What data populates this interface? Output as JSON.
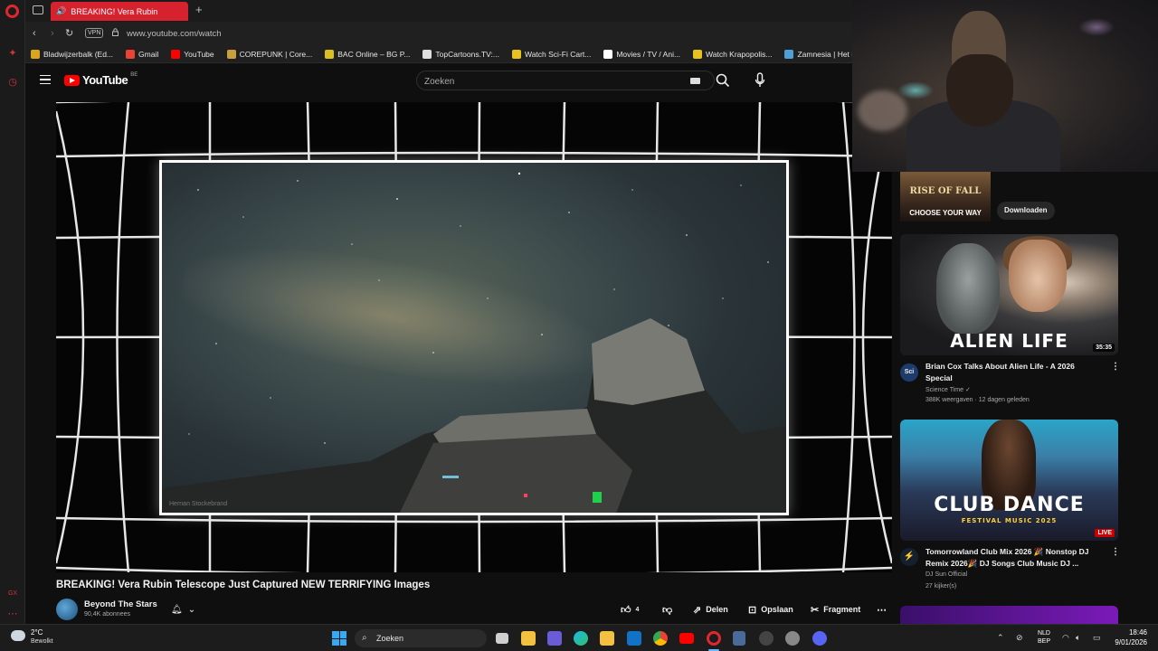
{
  "browser": {
    "tab_title": "BREAKING! Vera Rubin",
    "url": "www.youtube.com/watch",
    "vpn_label": "VPN",
    "new_tab_symbol": "+",
    "bookmarks": [
      {
        "label": "Bladwijzerbalk (Ed...",
        "icon": "folder-icon",
        "color": "#d9a520"
      },
      {
        "label": "Gmail",
        "icon": "gmail-icon",
        "color": "#ea4335"
      },
      {
        "label": "YouTube",
        "icon": "youtube-icon",
        "color": "#ff0000"
      },
      {
        "label": "COREPUNK | Core...",
        "icon": "corepunk-icon",
        "color": "#c8a040"
      },
      {
        "label": "BAC Online – BG P...",
        "icon": "bac-icon",
        "color": "#d9c020"
      },
      {
        "label": "TopCartoons.TV:...",
        "icon": "topcartoons-icon",
        "color": "#e0e0e0"
      },
      {
        "label": "Watch Sci-Fi Cart...",
        "icon": "scifi-icon",
        "color": "#e8c020"
      },
      {
        "label": "Movies / TV / Ani...",
        "icon": "play-icon",
        "color": "#ffffff"
      },
      {
        "label": "Watch Krapopolis...",
        "icon": "krapopolis-icon",
        "color": "#e8c020"
      },
      {
        "label": "Zamnesia | Het Be",
        "icon": "zamnesia-icon",
        "color": "#4fa0d8"
      }
    ]
  },
  "youtube": {
    "logo_text": "YouTube",
    "country_code": "BE",
    "search_placeholder": "Zoeken"
  },
  "video": {
    "title": "BREAKING! Vera Rubin Telescope Just Captured NEW TERRIFYING Images",
    "watermark": "Hernan Stockebrand",
    "channel_name": "Beyond The Stars",
    "subscribers": "90,4K abonnees",
    "like_count": "4",
    "actions": {
      "share": "Delen",
      "save": "Opslaan",
      "clip": "Fragment"
    }
  },
  "sidebar": {
    "ad": {
      "line1": "RISE OF FALL",
      "line2": "CHOOSE YOUR WAY",
      "download_label": "Downloaden"
    },
    "recommendations": [
      {
        "thumb_text": "ALIEN LIFE",
        "duration": "35:35",
        "title": "Brian Cox Talks About Alien Life - A 2026 Special",
        "channel": "Science Time",
        "meta": "388K weergaven · 12 dagen geleden",
        "avatar_text": "Sci"
      },
      {
        "thumb_text": "CLUB DANCE",
        "thumb_sub": "FESTIVAL MUSIC 2025",
        "badge": "LIVE",
        "title": "Tomorrowland Club Mix 2026 🎉 Nonstop DJ Remix 2026🎉 DJ Songs Club Music DJ ...",
        "channel": "DJ Sun Official",
        "meta": "27 kijker(s)"
      }
    ]
  },
  "taskbar": {
    "weather_temp": "2°C",
    "weather_desc": "Bewolkt",
    "search_placeholder": "Zoeken",
    "lang_top": "NLD",
    "lang_bottom": "BEP",
    "time": "18:46",
    "date": "9/01/2026"
  }
}
